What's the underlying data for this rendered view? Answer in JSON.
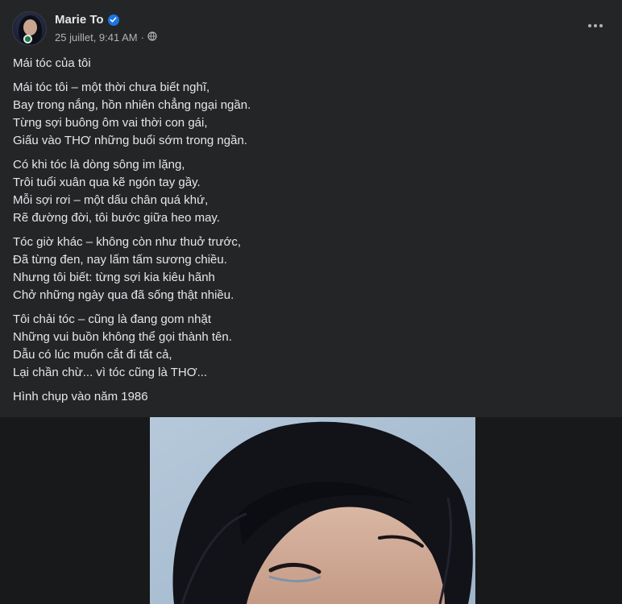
{
  "post": {
    "author": "Marie To",
    "timestamp": "25 juillet, 9:41 AM",
    "separator": "·",
    "icons": {
      "verified": "verified-badge-icon",
      "privacy": "globe-icon",
      "more": "more-options-icon"
    },
    "title": "Mái tóc của tôi",
    "stanzas": [
      [
        "Mái tóc tôi – một thời chưa biết nghĩ,",
        "Bay trong nắng, hồn nhiên chẳng ngại ngần.",
        "Từng sợi buông ôm vai thời con gái,",
        "Giấu vào THƠ những buổi sớm trong ngần."
      ],
      [
        "Có khi tóc là dòng sông im lặng,",
        "Trôi tuổi xuân qua kẽ ngón tay gầy.",
        "Mỗi sợi rơi – một dấu chân quá khứ,",
        "Rẽ đường đời, tôi bước giữa heo may."
      ],
      [
        "Tóc giờ khác – không còn như thuở trước,",
        "Đã từng đen, nay lấm tấm sương chiều.",
        "Nhưng tôi biết: từng sợi kia kiêu hãnh",
        "Chở những ngày qua đã sống thật nhiều."
      ],
      [
        "Tôi chải tóc – cũng là đang gom nhặt",
        "Những vui buồn không thể gọi thành tên.",
        "Dẫu có lúc muốn cắt đi tất cả,",
        "Lại chần chừ... vì tóc cũng là THƠ..."
      ]
    ],
    "caption": "Hình chụp vào năm 1986"
  },
  "colors": {
    "background": "#242526",
    "text": "#e4e6eb",
    "secondary_text": "#b0b3b8",
    "verified": "#1b74e4"
  }
}
